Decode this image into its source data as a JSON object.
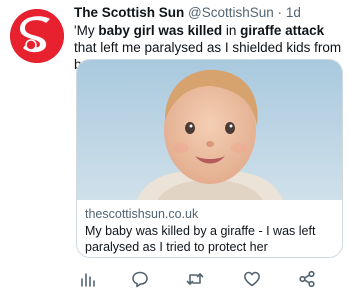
{
  "tweet": {
    "author_name": "The Scottish Sun",
    "author_handle": "@ScottishSun",
    "separator": "·",
    "timestamp": "1d",
    "text_segments": [
      {
        "text": "'My ",
        "bold": false
      },
      {
        "text": "baby girl was killed",
        "bold": true
      },
      {
        "text": " in ",
        "bold": false
      },
      {
        "text": "giraffe attack",
        "bold": true
      },
      {
        "text": " that left me paralysed as I shielded kids from beast'",
        "bold": false
      }
    ]
  },
  "card": {
    "domain": "thescottishsun.co.uk",
    "title": "My baby was killed by a giraffe - I was left paralysed as I tried to protect her"
  },
  "actions": {
    "icons": [
      "analytics-icon",
      "reply-icon",
      "retweet-icon",
      "like-icon",
      "share-icon"
    ]
  },
  "colors": {
    "brand_red": "#e8212f",
    "secondary_text": "#536471",
    "icon": "#536471"
  }
}
